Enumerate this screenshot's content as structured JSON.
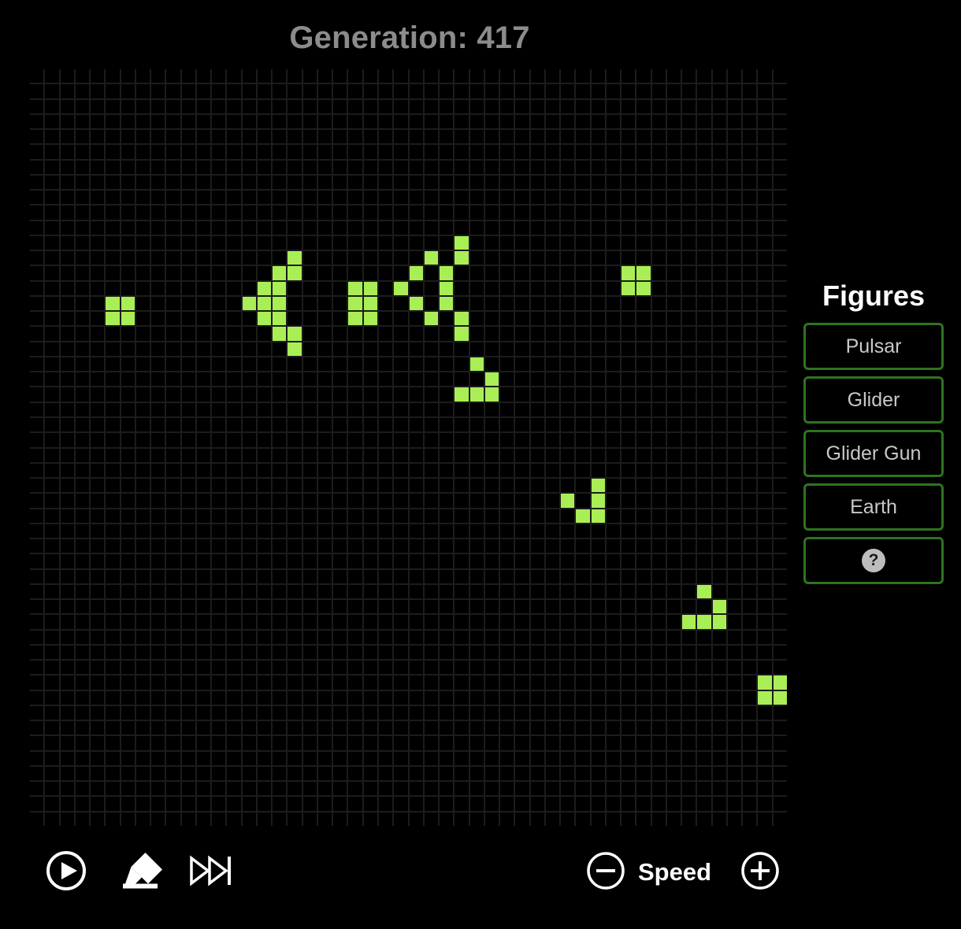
{
  "header": {
    "title": "Generation: 417",
    "generation": 417,
    "title_color": "#8c8c8c"
  },
  "grid": {
    "columns": 50,
    "rows": 50,
    "cell_color_alive": "#aaee55",
    "cell_color_dead": "#000000",
    "gridline_color": "#1c1c1c",
    "alive_cells": [
      [
        5,
        15
      ],
      [
        6,
        15
      ],
      [
        5,
        16
      ],
      [
        6,
        16
      ],
      [
        17,
        12
      ],
      [
        16,
        13
      ],
      [
        17,
        13
      ],
      [
        15,
        14
      ],
      [
        16,
        14
      ],
      [
        14,
        15
      ],
      [
        15,
        15
      ],
      [
        16,
        15
      ],
      [
        15,
        16
      ],
      [
        16,
        16
      ],
      [
        16,
        17
      ],
      [
        17,
        17
      ],
      [
        17,
        18
      ],
      [
        21,
        14
      ],
      [
        22,
        14
      ],
      [
        21,
        15
      ],
      [
        22,
        15
      ],
      [
        21,
        16
      ],
      [
        22,
        16
      ],
      [
        28,
        11
      ],
      [
        26,
        12
      ],
      [
        28,
        12
      ],
      [
        25,
        13
      ],
      [
        27,
        13
      ],
      [
        24,
        14
      ],
      [
        27,
        14
      ],
      [
        25,
        15
      ],
      [
        27,
        15
      ],
      [
        26,
        16
      ],
      [
        28,
        16
      ],
      [
        28,
        17
      ],
      [
        39,
        13
      ],
      [
        40,
        13
      ],
      [
        39,
        14
      ],
      [
        40,
        14
      ],
      [
        29,
        19
      ],
      [
        30,
        20
      ],
      [
        28,
        21
      ],
      [
        29,
        21
      ],
      [
        30,
        21
      ],
      [
        37,
        27
      ],
      [
        35,
        28
      ],
      [
        37,
        28
      ],
      [
        36,
        29
      ],
      [
        37,
        29
      ],
      [
        44,
        34
      ],
      [
        45,
        35
      ],
      [
        43,
        36
      ],
      [
        44,
        36
      ],
      [
        45,
        36
      ],
      [
        48,
        40
      ],
      [
        49,
        40
      ],
      [
        48,
        41
      ],
      [
        49,
        41
      ]
    ]
  },
  "figures": {
    "title": "Figures",
    "border_color": "#2e7320",
    "buttons": [
      {
        "label": "Pulsar",
        "name": "pulsar"
      },
      {
        "label": "Glider",
        "name": "glider"
      },
      {
        "label": "Glider Gun",
        "name": "glider-gun"
      },
      {
        "label": "Earth",
        "name": "earth"
      }
    ],
    "help_label": "?"
  },
  "controls": {
    "play_icon": "play-circle-icon",
    "erase_icon": "eraser-icon",
    "step_icon": "fast-forward-icon",
    "speed_down_icon": "minus-circle-icon",
    "speed_up_icon": "plus-circle-icon",
    "speed_label": "Speed"
  }
}
